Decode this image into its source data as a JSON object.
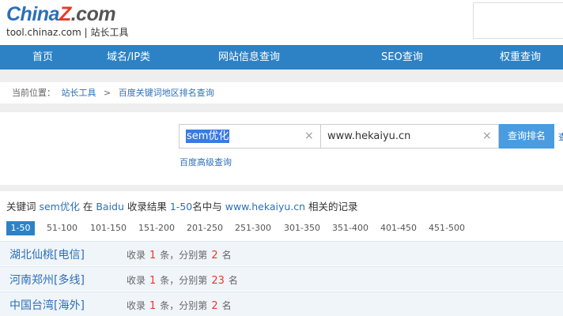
{
  "header": {
    "logo": {
      "part1": "China",
      "part2": "Z",
      "part3": ".com"
    },
    "subtitle": "tool.chinaz.com | 站长工具"
  },
  "nav": {
    "items": [
      {
        "label": "首页"
      },
      {
        "label": "域名/IP类"
      },
      {
        "label": "网站信息查询"
      },
      {
        "label": "SEO查询"
      },
      {
        "label": "权重查询"
      }
    ]
  },
  "breadcrumb": {
    "prefix": "当前位置：",
    "home": "站长工具",
    "separator": ">",
    "current": "百度关键词地区排名查询"
  },
  "search": {
    "keyword_value": "sem优化",
    "domain_value": "www.hekaiyu.cn",
    "clear_glyph": "×",
    "query_button": "查询排名",
    "advanced_link": "百度高级查询",
    "edge_fragment": "查"
  },
  "summary": {
    "t1": "关键词 ",
    "keyword": "sem优化",
    "t2": " 在 ",
    "engine": "Baidu",
    "t3": " 收录结果 ",
    "range": "1-50",
    "t4": "名中与 ",
    "domain": "www.hekaiyu.cn",
    "t5": " 相关的记录"
  },
  "pagination": {
    "pages": [
      "1-50",
      "51-100",
      "101-150",
      "151-200",
      "201-250",
      "251-300",
      "301-350",
      "351-400",
      "401-450",
      "451-500"
    ],
    "active_index": 0
  },
  "results": [
    {
      "location": "湖北仙桃[电信]",
      "pre": "收录",
      "count": "1",
      "mid": "条，分别第",
      "rank": "2",
      "post": "名"
    },
    {
      "location": "河南郑州[多线]",
      "pre": "收录",
      "count": "1",
      "mid": "条，分别第",
      "rank": "23",
      "post": "名"
    },
    {
      "location": "中国台湾[海外]",
      "pre": "收录",
      "count": "1",
      "mid": "条，分别第",
      "rank": "2",
      "post": "名"
    }
  ],
  "colors": {
    "nav_bg": "#2d82c6",
    "link": "#2d6fb7",
    "accent_red": "#e53a2a",
    "button_bg": "#4a9ce0",
    "row_bg": "#f0f5fa"
  }
}
